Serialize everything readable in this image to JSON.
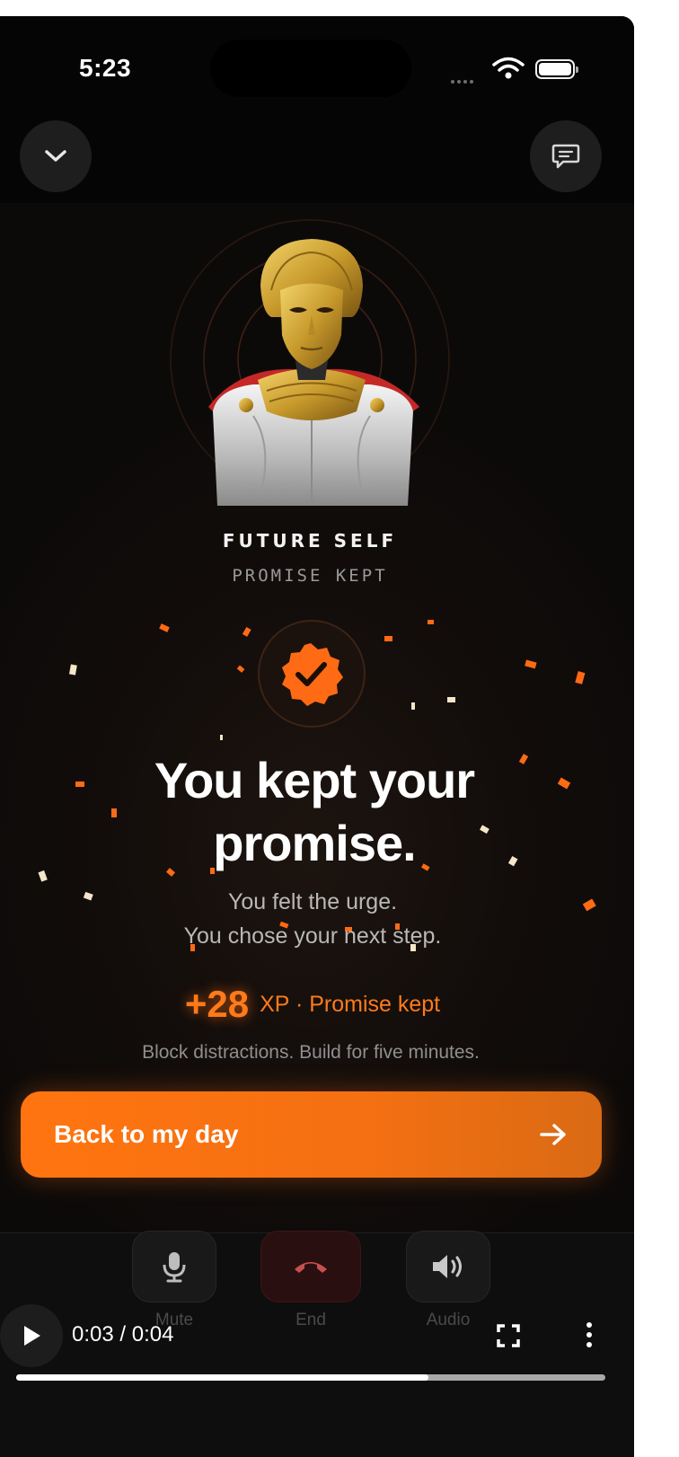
{
  "status_bar": {
    "time": "5:23"
  },
  "header": {
    "collapse_icon": "chevron-down-icon",
    "chat_icon": "chat-bubble-icon"
  },
  "avatar": {
    "image": "golden-masked-warrior-bust"
  },
  "persona": {
    "title": "FUTURE SELF",
    "subtitle": "PROMISE KEPT"
  },
  "badge": {
    "icon": "check-badge-icon",
    "color": "#ff6a14"
  },
  "message": {
    "headline": "You kept your promise.",
    "line1": "You felt the urge.",
    "line2": "You chose your next step."
  },
  "reward": {
    "xp_value": "+28",
    "xp_label": "XP · Promise kept",
    "hint": "Block distractions. Build for five minutes."
  },
  "cta": {
    "label": "Back to my day",
    "icon": "arrow-right-icon",
    "color": "#ff7410"
  },
  "call_controls": [
    {
      "label": "Mute",
      "icon": "microphone-icon"
    },
    {
      "label": "End",
      "icon": "phone-hangup-icon"
    },
    {
      "label": "Audio",
      "icon": "speaker-icon"
    }
  ],
  "video_player": {
    "time": "0:03 / 0:04",
    "progress": 0.7
  }
}
